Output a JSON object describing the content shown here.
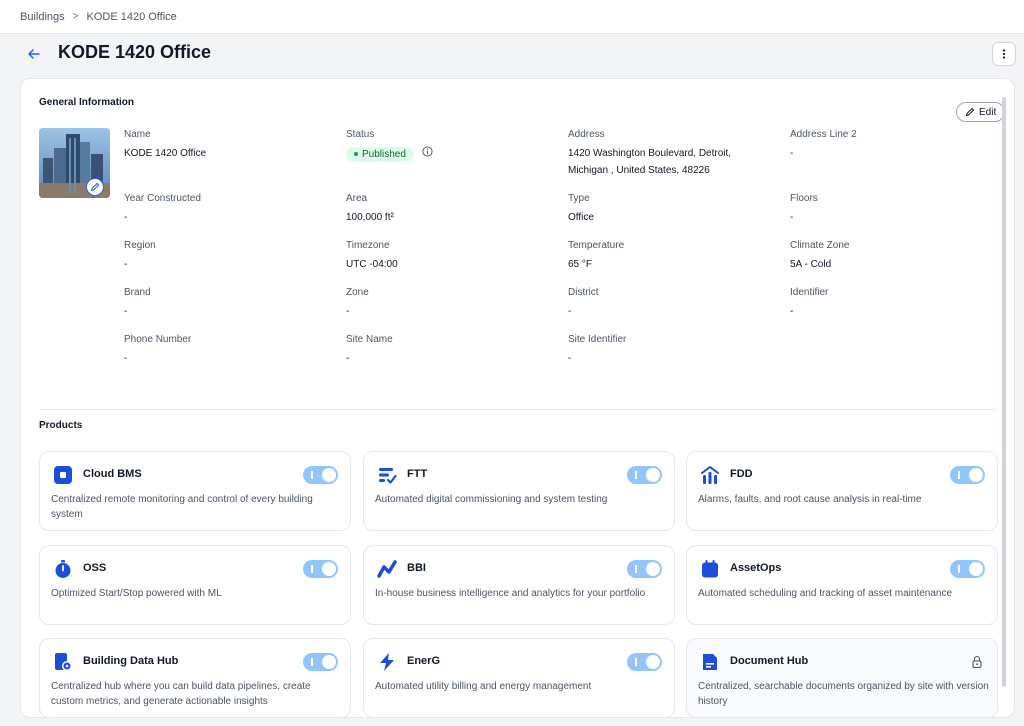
{
  "breadcrumb": {
    "root": "Buildings",
    "separator": ">",
    "current": "KODE 1420 Office"
  },
  "header": {
    "title": "KODE 1420 Office"
  },
  "general": {
    "title": "General Information",
    "edit_label": "Edit",
    "fields": [
      {
        "label": "Name",
        "value": "KODE 1420 Office"
      },
      {
        "label": "Status",
        "value": "Published"
      },
      {
        "label": "Address",
        "value_line1": "1420 Washington Boulevard, Detroit,",
        "value_line2": "Michigan , United States, 48226"
      },
      {
        "label": "Address Line 2",
        "value": "-"
      },
      {
        "label": "Year Constructed",
        "value": "-"
      },
      {
        "label": "Area",
        "value": "100,000 ft²"
      },
      {
        "label": "Type",
        "value": "Office"
      },
      {
        "label": "Floors",
        "value": "-"
      },
      {
        "label": "Region",
        "value": "-"
      },
      {
        "label": "Timezone",
        "value": "UTC -04:00"
      },
      {
        "label": "Temperature",
        "value": "65 °F"
      },
      {
        "label": "Climate Zone",
        "value": "5A - Cold"
      },
      {
        "label": "Brand",
        "value": "-"
      },
      {
        "label": "Zone",
        "value": "-"
      },
      {
        "label": "District",
        "value": "-"
      },
      {
        "label": "Identifier",
        "value": "-"
      },
      {
        "label": "Phone Number",
        "value": "-"
      },
      {
        "label": "Site Name",
        "value": "-"
      },
      {
        "label": "Site Identifier",
        "value": "-"
      }
    ]
  },
  "products": {
    "title": "Products",
    "items": [
      {
        "name": "Cloud BMS",
        "description": "Centralized remote monitoring and control of every building system",
        "enabled": true
      },
      {
        "name": "FTT",
        "description": "Automated digital commissioning and system testing",
        "enabled": true
      },
      {
        "name": "FDD",
        "description": "Alarms, faults, and root cause analysis in real-time",
        "enabled": true
      },
      {
        "name": "OSS",
        "description": "Optimized Start/Stop powered with ML",
        "enabled": true
      },
      {
        "name": "BBI",
        "description": "In-house business intelligence and analytics for your portfolio",
        "enabled": true
      },
      {
        "name": "AssetOps",
        "description": "Automated scheduling and tracking of asset maintenance",
        "enabled": true
      },
      {
        "name": "Building Data Hub",
        "description": "Centralized hub where you can build data pipelines, create custom metrics, and generate actionable insights",
        "enabled": true
      },
      {
        "name": "EnerG",
        "description": "Automated utility billing and energy management",
        "enabled": true
      },
      {
        "name": "Document Hub",
        "description": "Centralized, searchable documents organized by site with version history",
        "enabled": false,
        "locked": true
      }
    ]
  },
  "colors": {
    "accent": "#2563eb",
    "toggle_on": "#93c5fd",
    "status_bg": "#dcfce7",
    "status_text": "#166534"
  }
}
